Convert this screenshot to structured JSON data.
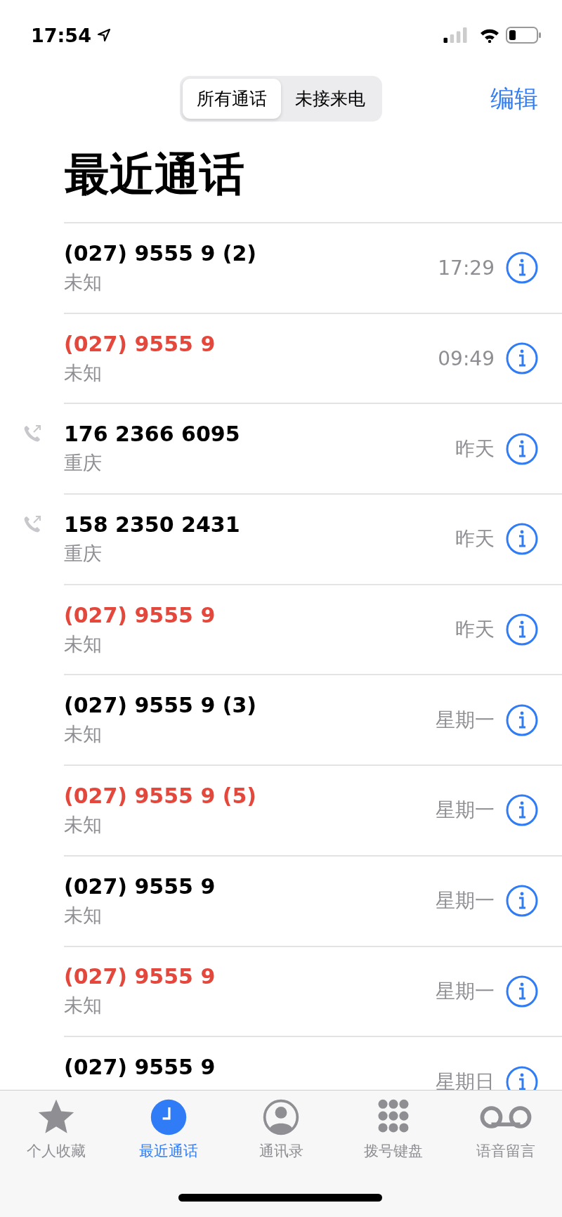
{
  "status_bar": {
    "time": "17:54"
  },
  "segments": [
    {
      "label": "所有通话",
      "selected": true
    },
    {
      "label": "未接来电",
      "selected": false
    }
  ],
  "edit_button": "编辑",
  "title": "最近通话",
  "calls": [
    {
      "name": "(027) 9555 9 (2)",
      "location": "未知",
      "time": "17:29",
      "missed": false,
      "outgoing": false
    },
    {
      "name": "(027) 9555 9",
      "location": "未知",
      "time": "09:49",
      "missed": true,
      "outgoing": false
    },
    {
      "name": "176 2366 6095",
      "location": "重庆",
      "time": "昨天",
      "missed": false,
      "outgoing": true
    },
    {
      "name": "158 2350 2431",
      "location": "重庆",
      "time": "昨天",
      "missed": false,
      "outgoing": true
    },
    {
      "name": "(027) 9555 9",
      "location": "未知",
      "time": "昨天",
      "missed": true,
      "outgoing": false
    },
    {
      "name": "(027) 9555 9 (3)",
      "location": "未知",
      "time": "星期一",
      "missed": false,
      "outgoing": false
    },
    {
      "name": "(027) 9555 9 (5)",
      "location": "未知",
      "time": "星期一",
      "missed": true,
      "outgoing": false
    },
    {
      "name": "(027) 9555 9",
      "location": "未知",
      "time": "星期一",
      "missed": false,
      "outgoing": false
    },
    {
      "name": "(027) 9555 9",
      "location": "未知",
      "time": "星期一",
      "missed": true,
      "outgoing": false
    },
    {
      "name": "(027) 9555 9",
      "time": "星期日",
      "missed": false,
      "outgoing": false
    }
  ],
  "tabs": [
    {
      "kind": "favorites",
      "label": "个人收藏",
      "selected": false
    },
    {
      "kind": "recents",
      "label": "最近通话",
      "selected": true
    },
    {
      "kind": "contacts",
      "label": "通讯录",
      "selected": false
    },
    {
      "kind": "keypad",
      "label": "拨号键盘",
      "selected": false
    },
    {
      "kind": "voicemail",
      "label": "语音留言",
      "selected": false
    }
  ]
}
